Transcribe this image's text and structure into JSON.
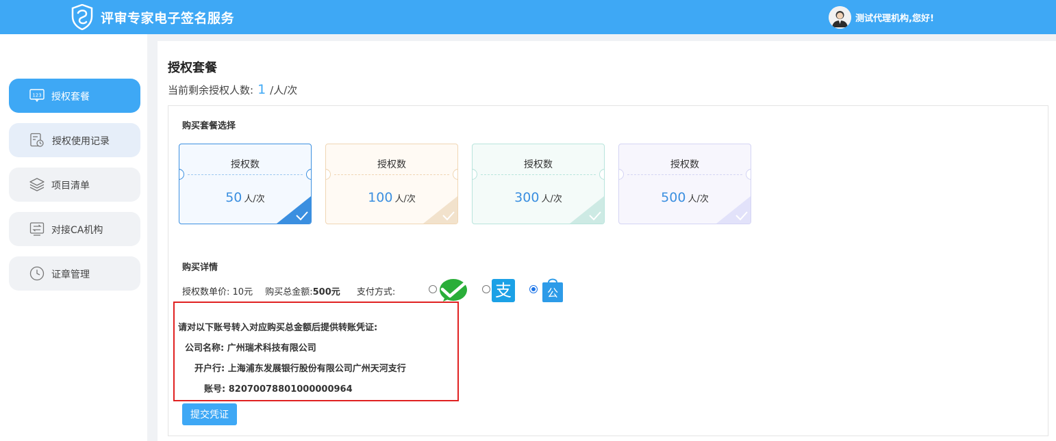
{
  "header": {
    "title": "评审专家电子签名服务",
    "greeting": "测试代理机构,您好!"
  },
  "sidebar": {
    "items": [
      {
        "label": "授权套餐",
        "icon": "badge-123-icon",
        "active": true
      },
      {
        "label": "授权使用记录",
        "icon": "record-icon"
      },
      {
        "label": "项目清单",
        "icon": "layers-icon"
      },
      {
        "label": "对接CA机构",
        "icon": "exchange-icon"
      },
      {
        "label": "证章管理",
        "icon": "clock-icon"
      }
    ]
  },
  "main": {
    "title": "授权套餐",
    "remain_label": "当前剩余授权人数:",
    "remain_value": "1",
    "remain_unit": "/人/次",
    "package_section_title": "购买套餐选择",
    "packages": [
      {
        "label": "授权数",
        "value": "50",
        "unit": "人/次",
        "selected": true,
        "color": "#3b8fe0"
      },
      {
        "label": "授权数",
        "value": "100",
        "unit": "人/次",
        "color": "#f0d6b4"
      },
      {
        "label": "授权数",
        "value": "300",
        "unit": "人/次",
        "color": "#b8e4dc"
      },
      {
        "label": "授权数",
        "value": "500",
        "unit": "人/次",
        "color": "#d4d4f4"
      }
    ],
    "detail_section_title": "购买详情",
    "unit_price_label": "授权数单价:",
    "unit_price": "10元",
    "total_label": "购买总金额:",
    "total": "500元",
    "pay_method_label": "支付方式:",
    "pay_methods": [
      {
        "icon": "wechat-pay-icon"
      },
      {
        "icon": "alipay-icon",
        "glyph": "支"
      },
      {
        "icon": "corporate-transfer-icon",
        "glyph": "公",
        "selected": true
      }
    ],
    "bank": {
      "instruction": "请对以下账号转入对应购买总金额后提供转账凭证:",
      "company_label": "公司名称:",
      "company": "广州瑞术科技有限公司",
      "bank_label": "开户行:",
      "bank": "上海浦东发展银行股份有限公司广州天河支行",
      "account_label": "账号:",
      "account": "82070078801000000964"
    },
    "submit_label": "提交凭证"
  }
}
